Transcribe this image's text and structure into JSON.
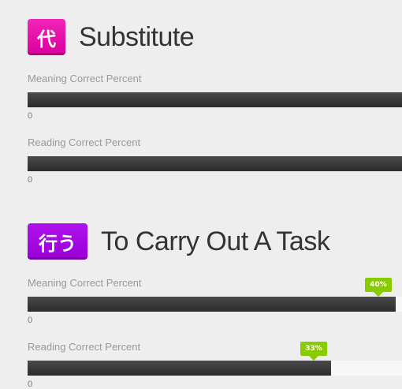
{
  "items": [
    {
      "character": "代",
      "meaning": "Substitute",
      "badge_color": "#e010a8",
      "stats": [
        {
          "label": "Meaning Correct Percent",
          "fraction": 1.0,
          "tag": "",
          "zero_label": "0"
        },
        {
          "label": "Reading Correct Percent",
          "fraction": 1.0,
          "tag": "",
          "zero_label": "0"
        }
      ]
    },
    {
      "character": "行う",
      "meaning": "To Carry Out A Task",
      "badge_color": "#a000e0",
      "stats": [
        {
          "label": "Meaning Correct Percent",
          "fraction": 0.983,
          "tag": "40%",
          "zero_label": "0"
        },
        {
          "label": "Reading Correct Percent",
          "fraction": 0.81,
          "tag": "33%",
          "zero_label": "0"
        }
      ]
    }
  ],
  "colors": {
    "bar_fill": "#333333",
    "bar_track": "#f7f7f7",
    "tag_green": "#88cc00"
  }
}
